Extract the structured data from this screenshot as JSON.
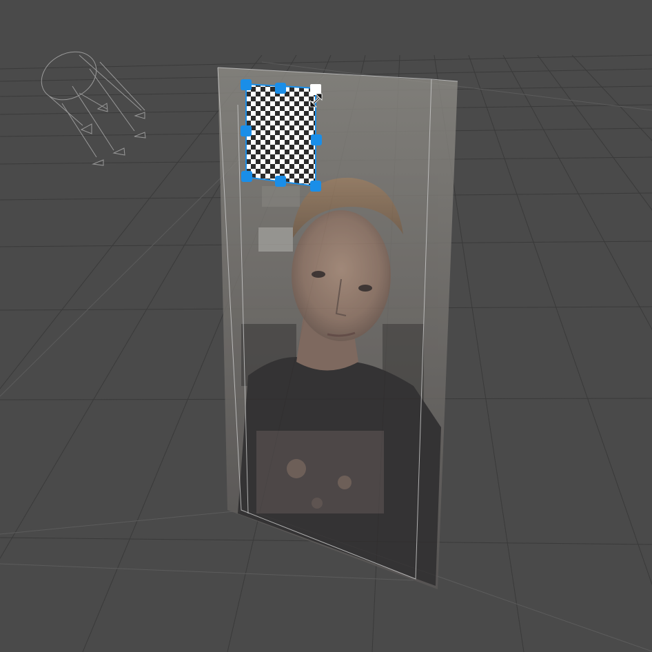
{
  "scene": {
    "background_color": "#4a4a4a",
    "selection_color": "#1a8ee8",
    "grid": "on",
    "view": "perspective"
  },
  "icons": {
    "light_gizmo": "directional-light-icon",
    "resize_cursor": "diagonal-resize-icon"
  },
  "objects": {
    "camera_plane": "photo",
    "selected_sprite": "transparent-checker"
  }
}
